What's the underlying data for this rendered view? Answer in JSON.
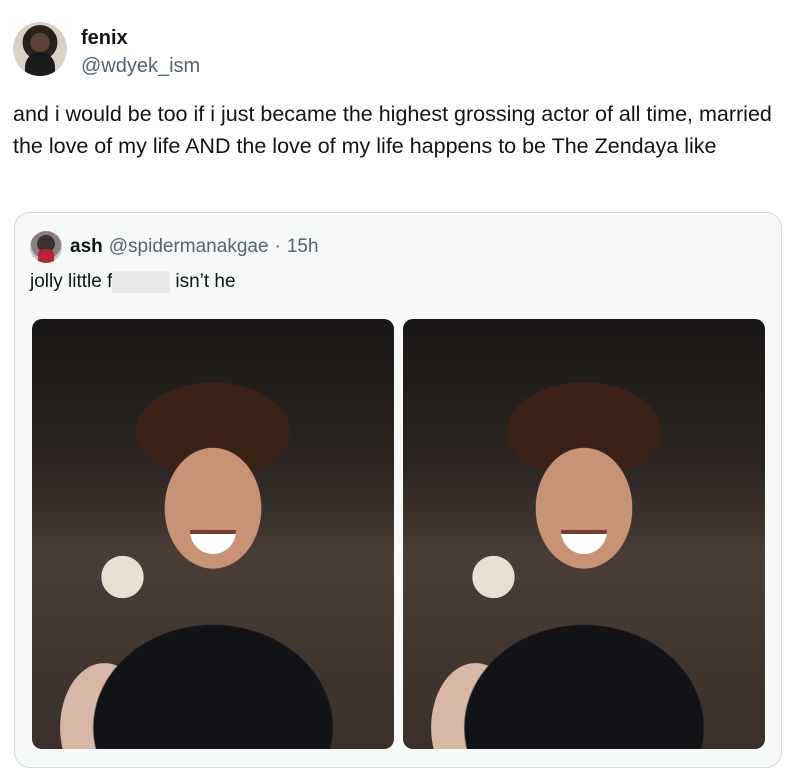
{
  "tweet": {
    "author": {
      "display_name": "fenix",
      "handle": "@wdyek_ism"
    },
    "text": "and i would be too if i just became the highest grossing actor of all time, married the love of my life AND the love of my life happens to be The Zendaya like"
  },
  "quoted_tweet": {
    "author": {
      "display_name": "ash",
      "handle": "@spidermanakgae"
    },
    "separator": "·",
    "time": "15h",
    "text_before": "jolly little f",
    "text_after": "isn’t he",
    "images": [
      "smiling man at awards ceremony",
      "smiling man at awards ceremony"
    ]
  }
}
